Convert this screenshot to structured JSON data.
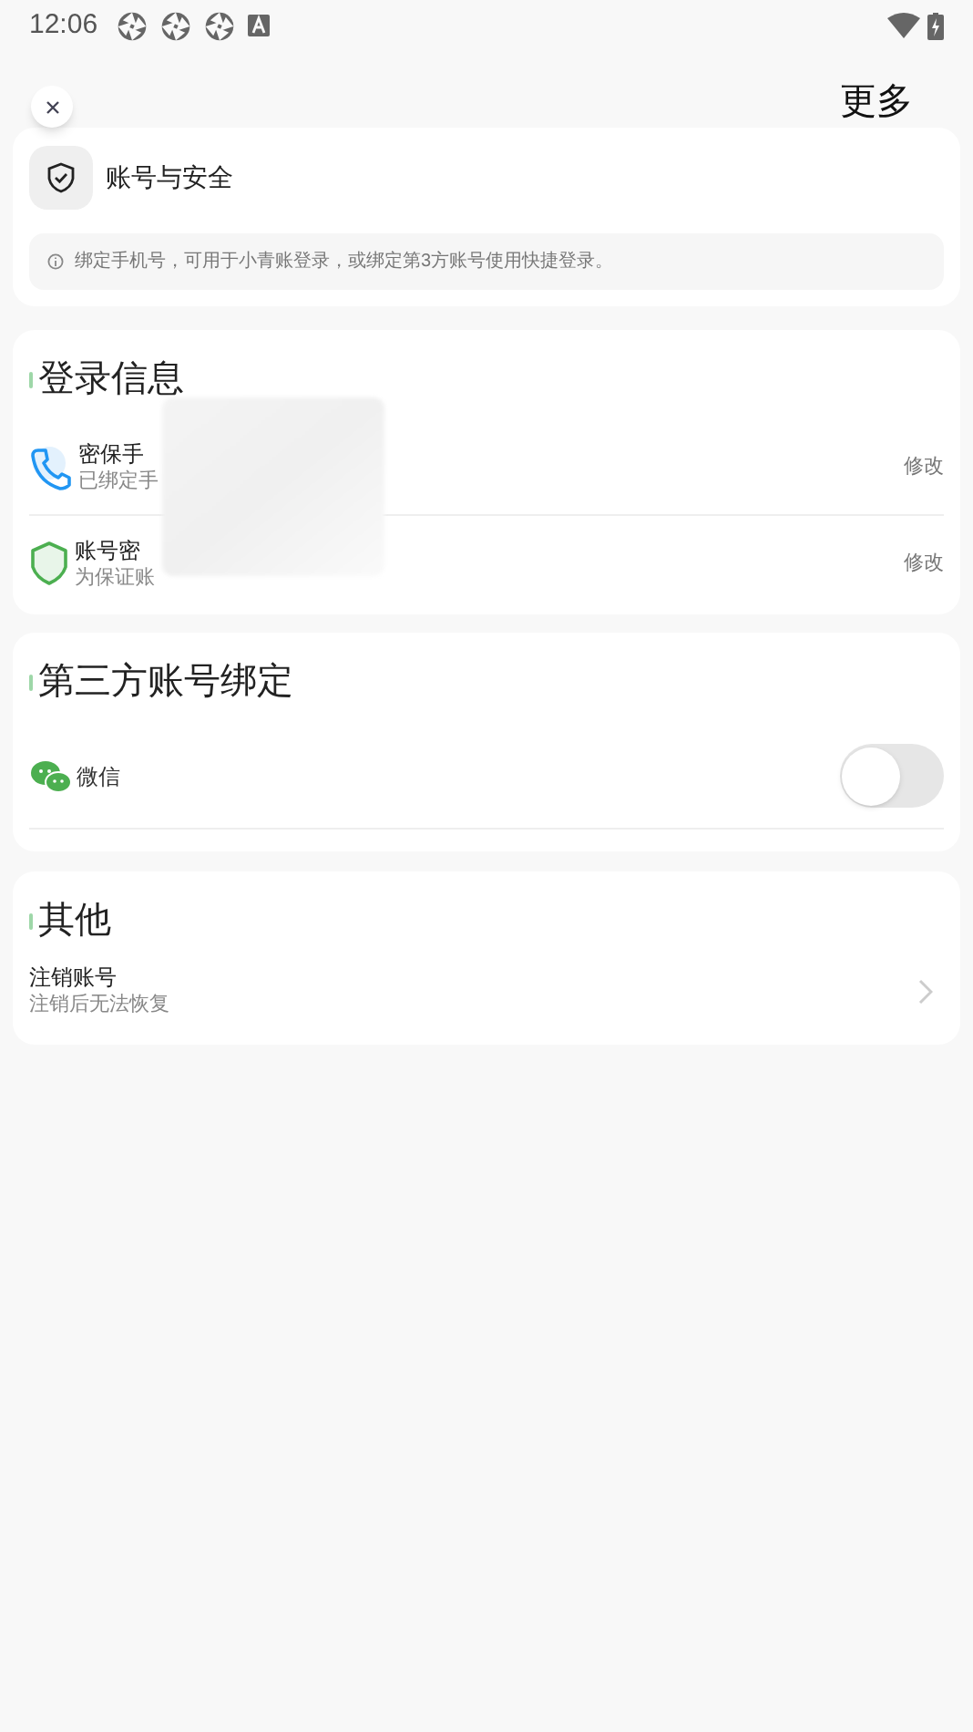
{
  "status_bar": {
    "time": "12:06"
  },
  "header": {
    "action": "更多"
  },
  "account_card": {
    "title": "账号与安全",
    "notice": "绑定手机号，可用于小青账登录，或绑定第3方账号使用快捷登录。"
  },
  "login_info": {
    "title": "登录信息",
    "items": [
      {
        "kind": "phone",
        "title": "密保手",
        "subtitle": "已绑定手",
        "action": "修改"
      },
      {
        "kind": "password",
        "title": "账号密",
        "subtitle": "为保证账",
        "action": "修改"
      }
    ]
  },
  "third_party": {
    "title": "第三方账号绑定",
    "items": [
      {
        "label": "微信",
        "on": false
      }
    ]
  },
  "other": {
    "title": "其他",
    "items": [
      {
        "title": "注销账号",
        "subtitle": "注销后无法恢复"
      }
    ]
  }
}
